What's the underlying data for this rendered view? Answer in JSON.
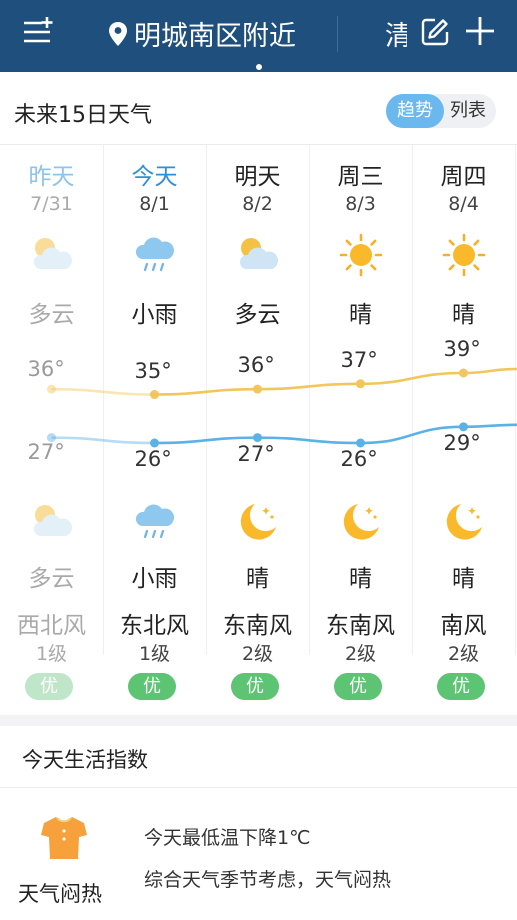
{
  "header": {
    "location": "明城南区附近",
    "location2": "清",
    "menu_icon": "menu-add-icon",
    "edit_icon": "edit-icon",
    "add_icon": "plus-icon"
  },
  "forecast": {
    "title": "未来15日天气",
    "toggle_trend": "趋势",
    "toggle_list": "列表",
    "days": [
      {
        "day": "昨天",
        "date": "7/31",
        "day_weather": "多云",
        "day_icon": "partly-cloudy-icon",
        "high": "36°",
        "low": "27°",
        "night_weather": "多云",
        "night_icon": "partly-cloudy-icon",
        "wind": "西北风",
        "wind_level": "1级",
        "aqi": "优"
      },
      {
        "day": "今天",
        "date": "8/1",
        "day_weather": "小雨",
        "day_icon": "light-rain-icon",
        "high": "35°",
        "low": "26°",
        "night_weather": "小雨",
        "night_icon": "light-rain-icon",
        "wind": "东北风",
        "wind_level": "1级",
        "aqi": "优"
      },
      {
        "day": "明天",
        "date": "8/2",
        "day_weather": "多云",
        "day_icon": "partly-cloudy-icon",
        "high": "36°",
        "low": "27°",
        "night_weather": "晴",
        "night_icon": "moon-icon",
        "wind": "东南风",
        "wind_level": "2级",
        "aqi": "优"
      },
      {
        "day": "周三",
        "date": "8/3",
        "day_weather": "晴",
        "day_icon": "sun-icon",
        "high": "37°",
        "low": "26°",
        "night_weather": "晴",
        "night_icon": "moon-icon",
        "wind": "东南风",
        "wind_level": "2级",
        "aqi": "优"
      },
      {
        "day": "周四",
        "date": "8/4",
        "day_weather": "晴",
        "day_icon": "sun-icon",
        "high": "39°",
        "low": "29°",
        "night_weather": "晴",
        "night_icon": "moon-icon",
        "wind": "南风",
        "wind_level": "2级",
        "aqi": "优"
      }
    ]
  },
  "chart_data": {
    "type": "line",
    "categories": [
      "7/31",
      "8/1",
      "8/2",
      "8/3",
      "8/4"
    ],
    "series": [
      {
        "values": [
          36,
          35,
          36,
          37,
          39
        ],
        "color": "#f2c65a"
      },
      {
        "values": [
          27,
          26,
          27,
          26,
          29
        ],
        "color": "#5bb2e6"
      }
    ]
  },
  "life": {
    "title": "今天生活指数",
    "label": "天气闷热",
    "icon": "shirt-icon",
    "line1": "今天最低温下降1℃",
    "line2": "综合天气季节考虑，天气闷热"
  }
}
